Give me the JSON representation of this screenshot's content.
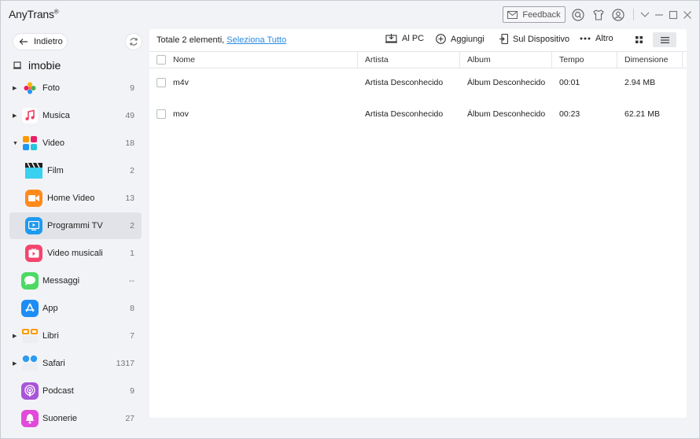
{
  "app": {
    "title": "AnyTrans",
    "registered": "®"
  },
  "titlebar": {
    "feedback_label": "Feedback"
  },
  "sidebar": {
    "back_label": "Indietro",
    "device_name": "imobie",
    "items": [
      {
        "label": "Foto",
        "count": "9",
        "icon": "photos-icon"
      },
      {
        "label": "Musica",
        "count": "49",
        "icon": "music-icon"
      },
      {
        "label": "Video",
        "count": "18",
        "icon": "video-icon"
      },
      {
        "label": "Film",
        "count": "2",
        "icon": "film-icon"
      },
      {
        "label": "Home Video",
        "count": "13",
        "icon": "home-video-icon"
      },
      {
        "label": "Programmi TV",
        "count": "2",
        "icon": "tv-icon"
      },
      {
        "label": "Video musicali",
        "count": "1",
        "icon": "music-video-icon"
      },
      {
        "label": "Messaggi",
        "count": "--",
        "icon": "messages-icon"
      },
      {
        "label": "App",
        "count": "8",
        "icon": "app-store-icon"
      },
      {
        "label": "Libri",
        "count": "7",
        "icon": "books-icon"
      },
      {
        "label": "Safari",
        "count": "1317",
        "icon": "safari-icon"
      },
      {
        "label": "Podcast",
        "count": "9",
        "icon": "podcast-icon"
      },
      {
        "label": "Suonerie",
        "count": "27",
        "icon": "ringtones-icon"
      }
    ]
  },
  "toolbar": {
    "total_text": "Totale 2 elementi, ",
    "select_all": "Seleziona Tutto",
    "to_pc": "Al PC",
    "add": "Aggiungi",
    "to_device": "Sul Dispositivo",
    "more": "Altro"
  },
  "table": {
    "columns": [
      "Nome",
      "Artista",
      "Album",
      "Tempo",
      "Dimensione"
    ],
    "rows": [
      {
        "name": "m4v",
        "artist": "Artista Desconhecido",
        "album": "Álbum Desconhecido",
        "time": "00:01",
        "size": "2.94 MB"
      },
      {
        "name": "mov",
        "artist": "Artista Desconhecido",
        "album": "Álbum Desconhecido",
        "time": "00:23",
        "size": "62.21 MB"
      }
    ]
  },
  "colors": {
    "link": "#2a8ae0",
    "active_nav": "#e1e3e8",
    "background": "#f2f3f6"
  }
}
